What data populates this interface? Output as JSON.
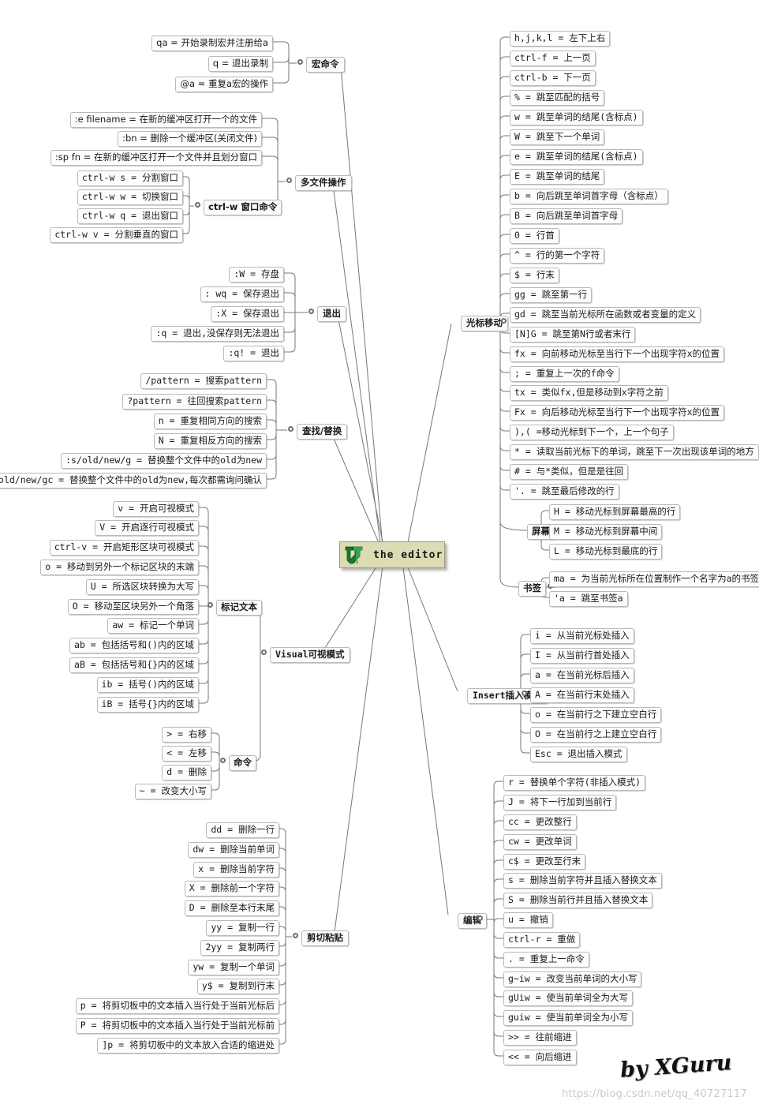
{
  "center": {
    "label": "the editor",
    "logo_icon": "vim-logo-icon",
    "bg_color": "#dcdcb4"
  },
  "credits": {
    "signature": "by XGuru",
    "watermark": "https://blog.csdn.net/qq_40727117"
  },
  "branches": [
    {
      "id": "macro",
      "label": "宏命令",
      "side": "left",
      "items": [
        "qa = 开始录制宏并注册给a",
        "q = 退出录制",
        "@a = 重复a宏的操作"
      ]
    },
    {
      "id": "multifile",
      "label": "多文件操作",
      "side": "left",
      "items": [
        ":e filename = 在新的缓冲区打开一个的文件",
        ":bn = 删除一个缓冲区(关闭文件)",
        ":sp fn = 在新的缓冲区打开一个文件并且划分窗口"
      ],
      "sub": {
        "label": "ctrl-w 窗口命令",
        "items": [
          "ctrl-w s = 分割窗口",
          "ctrl-w w = 切换窗口",
          "ctrl-w q = 退出窗口",
          "ctrl-w v = 分割垂直的窗口"
        ]
      }
    },
    {
      "id": "quit",
      "label": "退出",
      "side": "left",
      "items": [
        ":W = 存盘",
        ": wq = 保存退出",
        ":X = 保存退出",
        ":q = 退出,没保存则无法退出",
        ":q! = 退出"
      ]
    },
    {
      "id": "search",
      "label": "查找/替换",
      "side": "left",
      "items": [
        "/pattern = 搜索pattern",
        "?pattern = 往回搜索pattern",
        "n = 重复相同方向的搜索",
        "N = 重复相反方向的搜索",
        ":s/old/new/g = 替换整个文件中的old为new",
        ":s/old/new/gc = 替换整个文件中的old为new,每次都需询问确认"
      ]
    },
    {
      "id": "visual",
      "label": "Visual可视模式",
      "side": "left",
      "sub_mark": {
        "label": "标记文本",
        "items": [
          "v = 开启可视模式",
          "V = 开启逐行可视模式",
          "ctrl-v = 开启矩形区块可视模式",
          "o = 移动到另外一个标记区块的末端",
          "U = 所选区块转换为大写",
          "O = 移动至区块另外一个角落",
          "aw = 标记一个单词",
          "ab = 包括括号和()内的区域",
          "aB = 包括括号和{}内的区域",
          "ib = 括号()内的区域",
          "iB = 括号{}内的区域"
        ]
      },
      "sub_cmd": {
        "label": "命令",
        "items": [
          "> = 右移",
          "< = 左移",
          "d = 删除",
          "~ = 改变大小写"
        ]
      }
    },
    {
      "id": "clipboard",
      "label": "剪切粘贴",
      "side": "left",
      "items": [
        "dd = 删除一行",
        "dw = 删除当前单词",
        "x = 删除当前字符",
        "X = 删除前一个字符",
        "D = 删除至本行末尾",
        "yy = 复制一行",
        "2yy = 复制两行",
        "yw = 复制一个单词",
        "y$ = 复制到行末",
        "p = 将剪切板中的文本插入当行处于当前光标后",
        "P = 将剪切板中的文本插入当行处于当前光标前",
        "]p = 将剪切板中的文本放入合适的缩进处"
      ]
    },
    {
      "id": "cursor",
      "label": "光标移动",
      "side": "right",
      "items": [
        "h,j,k,l = 左下上右",
        "ctrl-f = 上一页",
        "ctrl-b = 下一页",
        "% = 跳至匹配的括号",
        "w = 跳至单词的结尾(含标点)",
        "W = 跳至下一个单词",
        "e = 跳至单词的结尾(含标点)",
        "E = 跳至单词的结尾",
        "b = 向后跳至单词首字母（含标点）",
        "B = 向后跳至单词首字母",
        "0 = 行首",
        "^ = 行的第一个字符",
        "$ = 行末",
        "gg = 跳至第一行",
        "gd = 跳至当前光标所在函数或者变量的定义",
        "[N]G = 跳至第N行或者末行",
        "fx = 向前移动光标至当行下一个出现字符x的位置",
        "; = 重复上一次的f命令",
        "tx = 类似fx,但是移动到x字符之前",
        "Fx = 向后移动光标至当行下一个出现字符x的位置",
        "),( =移动光标到下一个，上一个句子",
        "* = 读取当前光标下的单词，跳至下一次出现该单词的地方",
        "# = 与*类似，但是是往回",
        "'. = 跳至最后修改的行"
      ],
      "sub_screen": {
        "label": "屏幕",
        "items": [
          "H = 移动光标到屏幕最高的行",
          "M = 移动光标到屏幕中间",
          "L = 移动光标到最底的行"
        ]
      },
      "sub_mark": {
        "label": "书签",
        "items": [
          "ma = 为当前光标所在位置制作一个名字为a的书签",
          "'a = 跳至书签a"
        ]
      }
    },
    {
      "id": "insert",
      "label": "Insert插入模式",
      "side": "right",
      "items": [
        "i = 从当前光标处插入",
        "I = 从当前行首处插入",
        "a = 在当前光标后插入",
        "A = 在当前行末处插入",
        "o = 在当前行之下建立空白行",
        "O = 在当前行之上建立空白行",
        "Esc = 退出插入模式"
      ]
    },
    {
      "id": "edit",
      "label": "编辑",
      "side": "right",
      "items": [
        "r = 替换单个字符(非插入模式)",
        "J = 将下一行加到当前行",
        "cc = 更改整行",
        "cw = 更改单词",
        "c$ = 更改至行末",
        "s = 删除当前字符并且插入替换文本",
        "S = 删除当前行并且插入替换文本",
        "u = 撤销",
        "ctrl-r = 重做",
        ". = 重复上一命令",
        "g~iw = 改变当前单词的大小写",
        "gUiw = 使当前单词全为大写",
        "guiw = 使当前单词全为小写",
        ">> = 往前缩进",
        "<< = 向后缩进"
      ]
    }
  ]
}
